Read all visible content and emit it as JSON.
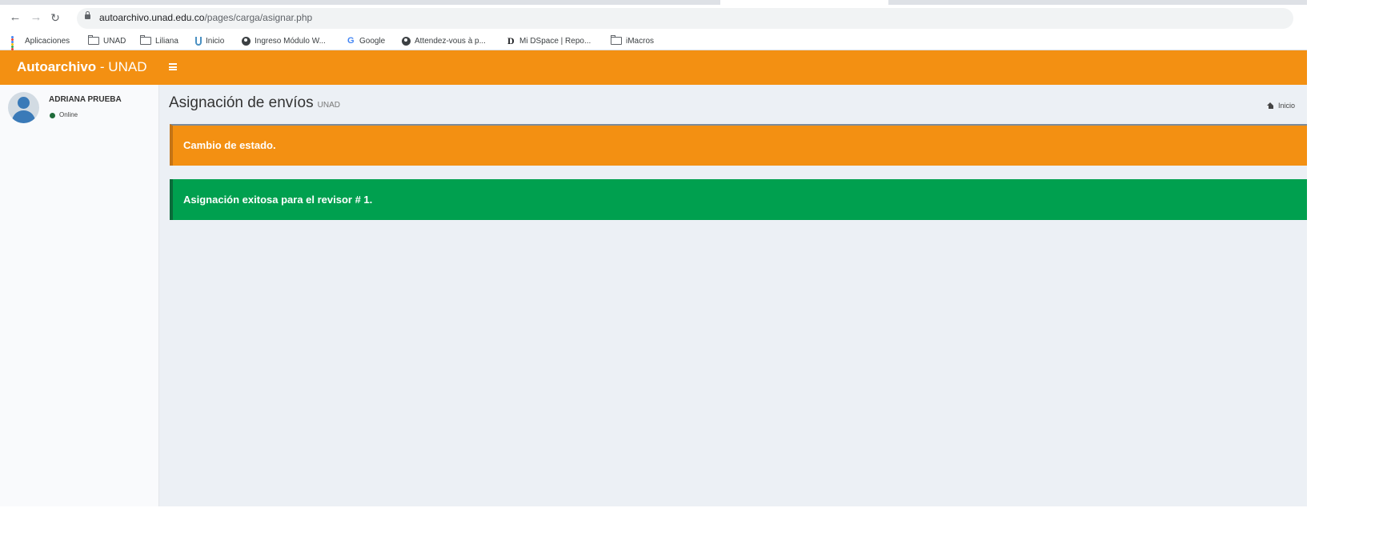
{
  "browser": {
    "url_host": "autoarchivo.unad.edu.co",
    "url_path": "/pages/carga/asignar.php",
    "bookmarks": [
      {
        "label": "Aplicaciones",
        "icon": "apps-grid-icon"
      },
      {
        "label": "UNAD",
        "icon": "folder-icon"
      },
      {
        "label": "Liliana",
        "icon": "folder-icon"
      },
      {
        "label": "Inicio",
        "icon": "u-logo-icon"
      },
      {
        "label": "Ingreso Módulo W...",
        "icon": "globe-icon"
      },
      {
        "label": "Google",
        "icon": "google-icon"
      },
      {
        "label": "Attendez-vous à p...",
        "icon": "globe-icon"
      },
      {
        "label": "Mi DSpace | Repo...",
        "icon": "dspace-icon"
      },
      {
        "label": "iMacros",
        "icon": "folder-icon"
      }
    ]
  },
  "header": {
    "brand_bold": "Autoarchivo",
    "brand_sep": " - ",
    "brand_light": "UNAD",
    "color": "#f39012"
  },
  "sidebar": {
    "user_name": "ADRIANA PRUEBA",
    "status": "Online"
  },
  "content": {
    "title": "Asignación de envíos",
    "subtitle": "UNAD",
    "breadcrumb_home": "Inicio"
  },
  "alerts": {
    "warning": "Cambio de estado.",
    "success": "Asignación exitosa para el revisor # 1.",
    "warning_color": "#f39012",
    "success_color": "#00a04f"
  }
}
